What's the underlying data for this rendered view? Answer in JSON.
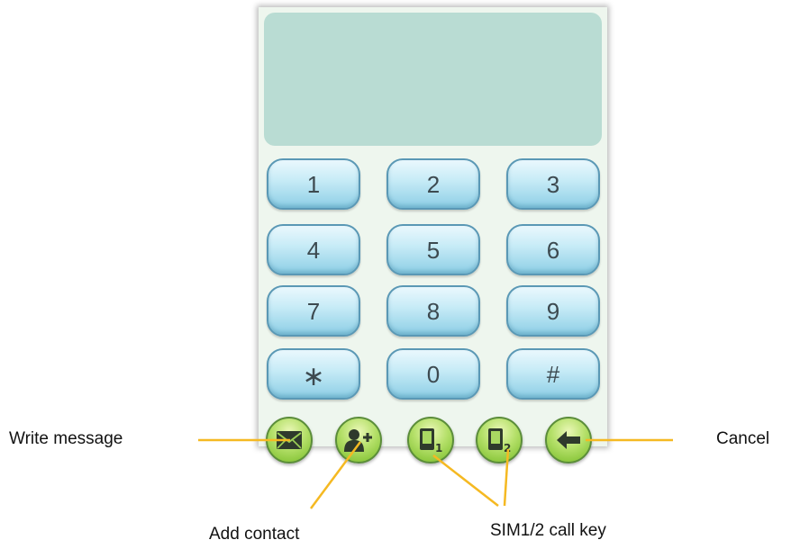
{
  "display": {
    "text": ""
  },
  "keypad": {
    "keys": [
      "1",
      "2",
      "3",
      "4",
      "5",
      "6",
      "7",
      "8",
      "9",
      "∗",
      "0",
      "#"
    ]
  },
  "actions": [
    {
      "name": "write-message-button",
      "icon": "envelope-icon"
    },
    {
      "name": "add-contact-button",
      "icon": "add-person-icon"
    },
    {
      "name": "sim1-call-button",
      "icon": "sim1-phone-icon",
      "badge": "1"
    },
    {
      "name": "sim2-call-button",
      "icon": "sim2-phone-icon",
      "badge": "2"
    },
    {
      "name": "cancel-button",
      "icon": "back-arrow-icon"
    }
  ],
  "callouts": {
    "write_message": "Write message",
    "cancel": "Cancel",
    "add_contact": "Add contact",
    "sim_call": "SIM1/2 call key"
  },
  "colors": {
    "display": "#b9dcd3",
    "key_face": "#c9ecf7",
    "action_button": "#8ec940",
    "leader_line": "#f5b922"
  }
}
